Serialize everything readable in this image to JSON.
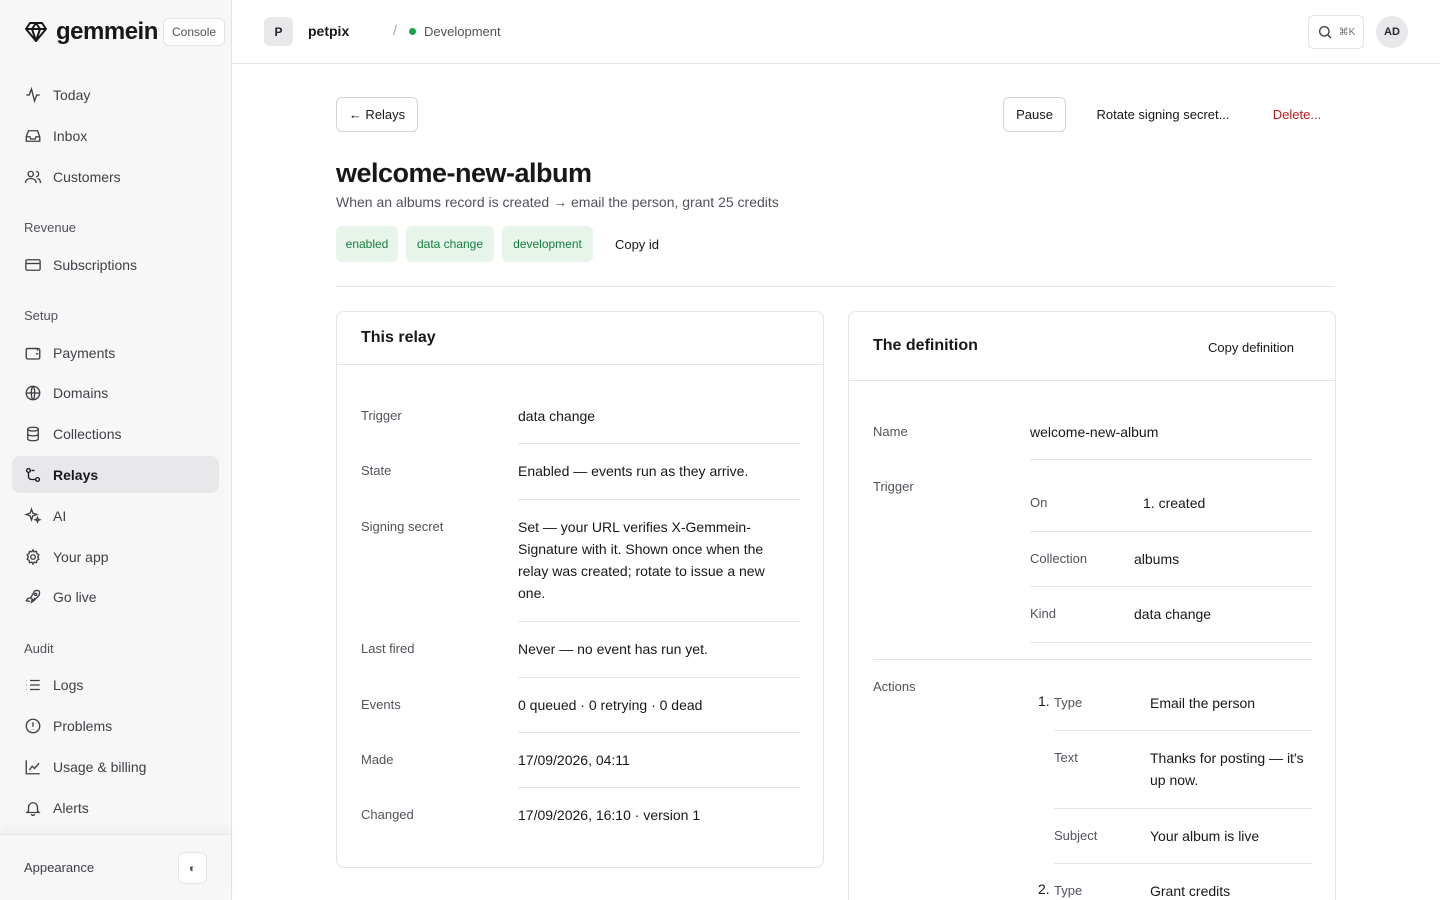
{
  "brand": {
    "name": "gemmein",
    "console_label": "Console"
  },
  "sidebar": {
    "primary": [
      {
        "label": "Today",
        "icon": "activity-icon"
      },
      {
        "label": "Inbox",
        "icon": "inbox-icon"
      },
      {
        "label": "Customers",
        "icon": "users-icon"
      }
    ],
    "sections": [
      {
        "title": "Revenue",
        "items": [
          {
            "label": "Subscriptions",
            "icon": "credit-card-icon"
          }
        ]
      },
      {
        "title": "Setup",
        "items": [
          {
            "label": "Payments",
            "icon": "wallet-icon"
          },
          {
            "label": "Domains",
            "icon": "globe-icon"
          },
          {
            "label": "Collections",
            "icon": "database-icon"
          },
          {
            "label": "Relays",
            "icon": "relay-icon",
            "active": true
          },
          {
            "label": "AI",
            "icon": "sparkles-icon"
          },
          {
            "label": "Your app",
            "icon": "gear-icon"
          },
          {
            "label": "Go live",
            "icon": "rocket-icon"
          }
        ]
      },
      {
        "title": "Audit",
        "items": [
          {
            "label": "Logs",
            "icon": "list-icon"
          },
          {
            "label": "Problems",
            "icon": "alert-circle-icon"
          },
          {
            "label": "Usage & billing",
            "icon": "chart-icon"
          },
          {
            "label": "Alerts",
            "icon": "bell-icon"
          }
        ]
      }
    ],
    "footer": {
      "appearance_label": "Appearance",
      "toggle_glyph": "◐"
    }
  },
  "topbar": {
    "project_initial": "P",
    "project_name": "petpix",
    "separator": "/",
    "environment": "Development",
    "search_shortcut": "⌘K",
    "user_initials": "AD"
  },
  "colors": {
    "env_dot": "#16a34a",
    "badge_bg": "#e6f4ea",
    "badge_text": "#15803d",
    "danger": "#b91c1c",
    "active_nav_bg": "#e8e8eb"
  },
  "toolbar": {
    "back_label": "← Relays",
    "pause_label": "Pause",
    "rotate_label": "Rotate signing secret...",
    "delete_label": "Delete..."
  },
  "relay": {
    "name": "welcome-new-album",
    "description": "When an albums record is created → email the person, grant 25 credits",
    "badges": [
      "enabled",
      "data change",
      "development"
    ],
    "copy_id_label": "Copy id"
  },
  "this_relay": {
    "title": "This relay",
    "rows": [
      {
        "label": "Trigger",
        "value": "data change"
      },
      {
        "label": "State",
        "value": "Enabled — events run as they arrive."
      },
      {
        "label": "Signing secret",
        "value": "Set — your URL verifies X-Gemmein-Signature with it. Shown once when the relay was created; rotate to issue a new one."
      },
      {
        "label": "Last fired",
        "value": "Never — no event has run yet."
      },
      {
        "label": "Events",
        "value": "0 queued · 0 retrying · 0 dead"
      },
      {
        "label": "Made",
        "value": "17/09/2026, 04:11"
      },
      {
        "label": "Changed",
        "value": "17/09/2026, 16:10 · version 1"
      }
    ]
  },
  "definition": {
    "title": "The definition",
    "copy_label": "Copy definition",
    "name_label": "Name",
    "name_value": "welcome-new-album",
    "trigger_label": "Trigger",
    "trigger": {
      "on_label": "On",
      "on_value": "1. created",
      "collection_label": "Collection",
      "collection_value": "albums",
      "kind_label": "Kind",
      "kind_value": "data change"
    },
    "actions_label": "Actions",
    "actions": [
      {
        "number": "1.",
        "type_label": "Type",
        "type_value": "Email the person",
        "text_label": "Text",
        "text_value": "Thanks for posting — it's up now.",
        "subject_label": "Subject",
        "subject_value": "Your album is live"
      },
      {
        "number": "2.",
        "type_label": "Type",
        "type_value": "Grant credits"
      }
    ]
  }
}
